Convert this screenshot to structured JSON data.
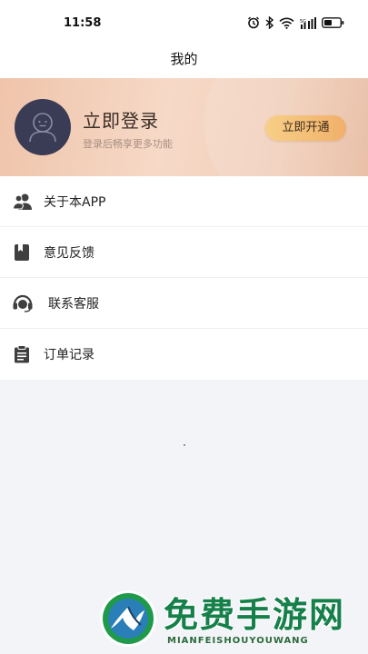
{
  "status_bar": {
    "time": "11:58",
    "icons": [
      "alarm-icon",
      "bluetooth-icon",
      "wifi-icon",
      "signal-icon",
      "battery-icon"
    ]
  },
  "header": {
    "title": "我的"
  },
  "login_banner": {
    "title": "立即登录",
    "subtitle": "登录后畅享更多功能",
    "button_label": "立即开通",
    "avatar_icon": "user-avatar-icon"
  },
  "menu": {
    "items": [
      {
        "label": "关于本APP",
        "icon": "users-icon"
      },
      {
        "label": "意见反馈",
        "icon": "bookmark-book-icon"
      },
      {
        "label": "联系客服",
        "icon": "headset-icon"
      },
      {
        "label": "订单记录",
        "icon": "clipboard-icon"
      }
    ]
  },
  "watermark": {
    "title": "免费手游网",
    "subtitle": "MIANFEISHOUYOUWANG"
  },
  "colors": {
    "accent_gold": "#f0b06a",
    "avatar_bg": "#3a3c55",
    "background": "#f3f4f8"
  }
}
